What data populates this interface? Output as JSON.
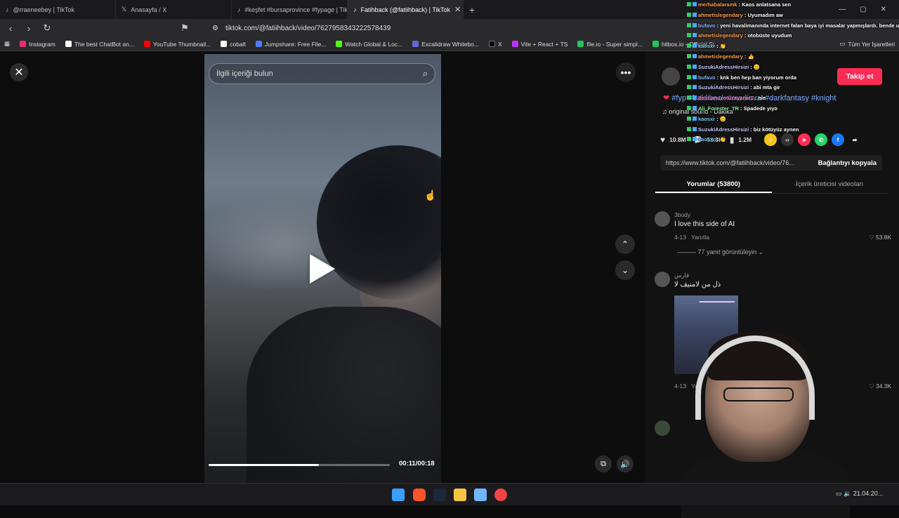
{
  "tabs": [
    {
      "title": "@rraeneebey | TikTok",
      "icon": "tiktok-icon"
    },
    {
      "title": "Anasayfa / X",
      "icon": "x-icon"
    },
    {
      "title": "#keşfet #bursaprovince #fypage | Tik",
      "icon": "tiktok-icon"
    },
    {
      "title": "Fatihback (@fatiihback) | TikTok",
      "icon": "tiktok-icon",
      "active": true
    }
  ],
  "url": "tiktok.com/@fatiihback/video/7627958343222578439",
  "bookmarks": [
    {
      "label": "Instagram",
      "color": "#e1306c"
    },
    {
      "label": "The best ChatBot an...",
      "color": "#ffffff"
    },
    {
      "label": "YouTube Thumbnail...",
      "color": "#ff0000"
    },
    {
      "label": "cobalt",
      "color": "#ffffff"
    },
    {
      "label": "Jumpshare: Free File...",
      "color": "#4a7cf7"
    },
    {
      "label": "Watch Global & Loc...",
      "color": "#53fc18"
    },
    {
      "label": "Excalidraw Whitebo...",
      "color": "#6965db"
    },
    {
      "label": "X",
      "color": "#000000"
    },
    {
      "label": "Vite + React + TS",
      "color": "#bd34fe"
    },
    {
      "label": "file.io - Super simpl...",
      "color": "#22c55e"
    },
    {
      "label": "hitbox.io - Official Si...",
      "color": "#22c55e"
    }
  ],
  "bookmarks_all": "Tüm Yer İşaretleri",
  "video": {
    "search_placeholder": "İlgili içeriği bulun",
    "time": "00:11/00:18",
    "progress": 0.61
  },
  "follow_label": "Takip et",
  "hashtags": "#fyp #baldiback #medieval #darkfantasy #knight",
  "sound": "original sound - Dakika",
  "stats": {
    "likes": "10.8M",
    "comments": "53.8K",
    "saves": "1.2M"
  },
  "share_link": "https://www.tiktok.com/@fatiihback/video/76...",
  "copy_label": "Bağlantıyı kopyala",
  "panel_tabs": [
    "Yorumlar (53800)",
    "İçerik üreticisi videoları"
  ],
  "comments": [
    {
      "user": "3body",
      "text": "I love this side of AI",
      "date": "4-13",
      "reply": "Yanıtla",
      "likes": "53.8K",
      "replies": "77 yanıt görüntüleyin"
    },
    {
      "user": "فارس",
      "text": "ذل من لامنيف لا",
      "date": "4-13",
      "reply": "Ya",
      "likes": "34.3K"
    }
  ],
  "chat": [
    {
      "user": "merhabalaramk",
      "msg": "Kaos anlatsana sen",
      "color": "#ff9d4d"
    },
    {
      "user": "ahmetislegendary",
      "msg": "Uyumadım aw",
      "color": "#ff9d4d"
    },
    {
      "user": "bufavo",
      "msg": "yeni havalimanında internet falan baya iyi masalar yapmışlardı. bende uçağa yanlışlıkla 1 gün erken gelmiştim oturup 20 saat urf oynayıp beleş turkcell kahvesi içmiştim",
      "color": "#8fb4ff"
    },
    {
      "user": "ahmetislegendary",
      "msg": "otobüste uyudum",
      "color": "#ff9d4d"
    },
    {
      "user": "kaosxr",
      "msg": "👏",
      "color": "#7bd3ff"
    },
    {
      "user": "ahmetislegendary",
      "msg": "👍",
      "color": "#ff9d4d"
    },
    {
      "user": "SuzukiAdressHirsizi",
      "msg": "😊",
      "color": "#c9c9ff"
    },
    {
      "user": "bufavo",
      "msg": "knk ben hep ban yiyorum orda",
      "color": "#8fb4ff"
    },
    {
      "user": "SuzukiAdressHirsizi",
      "msg": "abi mta gir",
      "color": "#c9c9ff"
    },
    {
      "user": "dostumuzotuzayanat1",
      "msg": "nie",
      "color": "#ff8ad1"
    },
    {
      "user": "Ali_Forester_TR",
      "msg": "Spadede yiyo",
      "color": "#7bff9a"
    },
    {
      "user": "kaosxr",
      "msg": "😊",
      "color": "#7bd3ff"
    },
    {
      "user": "SuzukiAdressHirsizi",
      "msg": "biz kötüyüz aynen",
      "color": "#c9c9ff"
    },
    {
      "user": "kaosxr",
      "msg": "👏",
      "color": "#7bd3ff"
    }
  ],
  "clock": "21.04.20..."
}
